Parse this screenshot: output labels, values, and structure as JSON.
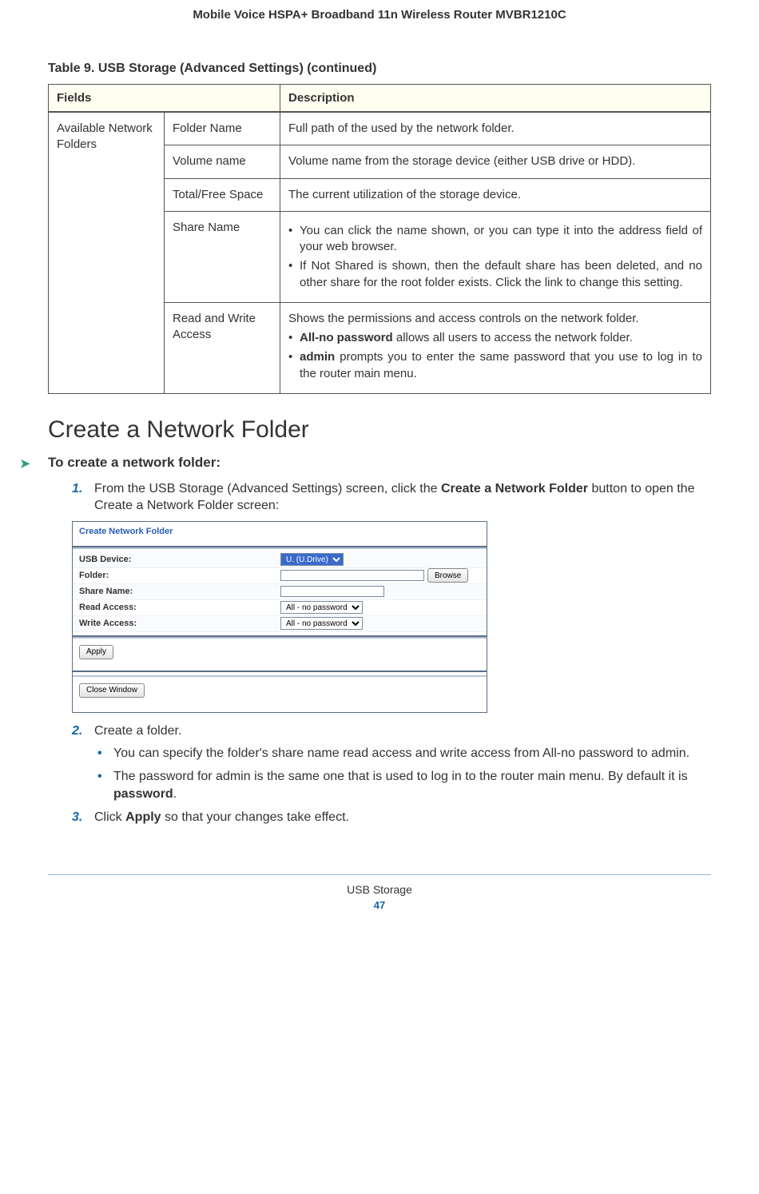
{
  "header": "Mobile Voice HSPA+ Broadband 11n Wireless Router MVBR1210C",
  "table": {
    "caption": "Table 9.  USB Storage (Advanced Settings)  (continued)",
    "col1": "Fields",
    "col2": "Description",
    "group": "Available Network Folders",
    "rows": [
      {
        "field": "Folder Name",
        "desc": "Full path of the used by the network folder."
      },
      {
        "field": "Volume name",
        "desc": "Volume name from the storage device (either USB drive or HDD)."
      },
      {
        "field": "Total/Free Space",
        "desc": "The current utilization of the storage device."
      },
      {
        "field": "Share Name",
        "bullets": [
          "You can click the name shown, or you can type it into the address field of your web browser.",
          "If Not Shared is shown, then the default share has been deleted, and no other share for the root folder exists. Click the link to change this setting."
        ]
      },
      {
        "field": "Read and Write Access",
        "lead": "Shows the permissions and access controls on the network folder.",
        "bullets_rw": [
          {
            "bold": "All-no password",
            "rest": " allows all users to access the network folder."
          },
          {
            "bold": "admin",
            "rest": " prompts you to enter the same password that you use to log in to the router main menu."
          }
        ]
      }
    ]
  },
  "section_title": "Create a Network Folder",
  "procedure_title": "To create a network folder:",
  "step1_pre": "From the USB Storage (Advanced Settings) screen, click the ",
  "step1_bold": "Create a Network Folder",
  "step1_post": " button to open the Create a Network Folder screen:",
  "ui": {
    "title": "Create Network Folder",
    "rows": {
      "usb_label": "USB Device:",
      "usb_value": "U. (U.Drive)",
      "folder_label": "Folder:",
      "folder_value": "",
      "browse": "Browse",
      "share_label": "Share Name:",
      "share_value": "",
      "read_label": "Read Access:",
      "read_value": "All - no password",
      "write_label": "Write Access:",
      "write_value": "All - no password"
    },
    "apply": "Apply",
    "close": "Close Window"
  },
  "step2": "Create a folder.",
  "step2_sub1": "You can specify the folder's share name read access and write access from All-no password to admin.",
  "step2_sub2_pre": "The password for admin is the same one that is used to log in to the router main menu. By default it is ",
  "step2_sub2_bold": "password",
  "step2_sub2_post": ".",
  "step3_pre": "Click ",
  "step3_bold": "Apply",
  "step3_post": " so that your changes take effect.",
  "footer_title": "USB Storage",
  "footer_page": "47"
}
